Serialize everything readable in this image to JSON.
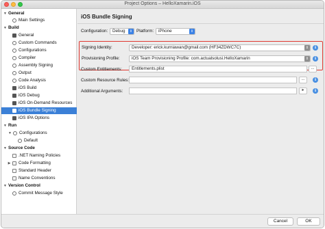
{
  "window": {
    "title": "Project Options – HelloXamarin.iOS"
  },
  "sidebar": {
    "items": [
      {
        "label": "General",
        "expand": "▼"
      },
      {
        "label": "Main Settings"
      },
      {
        "label": "Build",
        "expand": "▼"
      },
      {
        "label": "General"
      },
      {
        "label": "Custom Commands"
      },
      {
        "label": "Configurations"
      },
      {
        "label": "Compiler"
      },
      {
        "label": "Assembly Signing"
      },
      {
        "label": "Output"
      },
      {
        "label": "Code Analysis"
      },
      {
        "label": "iOS Build"
      },
      {
        "label": "iOS Debug"
      },
      {
        "label": "iOS On-Demand Resources"
      },
      {
        "label": "iOS Bundle Signing"
      },
      {
        "label": "iOS IPA Options"
      },
      {
        "label": "Run",
        "expand": "▼"
      },
      {
        "label": "Configurations",
        "expand": "▼"
      },
      {
        "label": "Default"
      },
      {
        "label": "Source Code",
        "expand": "▼"
      },
      {
        "label": ".NET Naming Policies"
      },
      {
        "label": "Code Formatting",
        "expand": "▶"
      },
      {
        "label": "Standard Header"
      },
      {
        "label": "Name Conventions"
      },
      {
        "label": "Version Control",
        "expand": "▼"
      },
      {
        "label": "Commit Message Style"
      }
    ]
  },
  "main": {
    "title": "iOS Bundle Signing",
    "configuration_label": "Configuration:",
    "configuration_value": "Debug",
    "platform_label": "Platform:",
    "platform_value": "iPhone",
    "signing_identity_label": "Signing Identity:",
    "signing_identity_value": "Developer: erick.kurniawan@gmail.com (HF34ZDWC7C)",
    "provisioning_profile_label": "Provisioning Profile:",
    "provisioning_profile_value": "iOS Team Provisioning Profile: com.actualsolusi.HelloXamarin",
    "custom_entitlements_label": "Custom Entitlements:",
    "custom_entitlements_value": "Entitlements.plist",
    "custom_resource_rules_label": "Custom Resource Rules:",
    "custom_resource_rules_value": "",
    "additional_arguments_label": "Additional Arguments:",
    "additional_arguments_value": "",
    "browse_label": "...",
    "add_label": "▸",
    "info_glyph": "i"
  },
  "footer": {
    "cancel_label": "Cancel",
    "ok_label": "OK"
  },
  "colors": {
    "selection": "#3b80d7",
    "highlight_border": "#e0372f",
    "popup_accent": "#3b82e6",
    "info": "#4a90e2"
  }
}
